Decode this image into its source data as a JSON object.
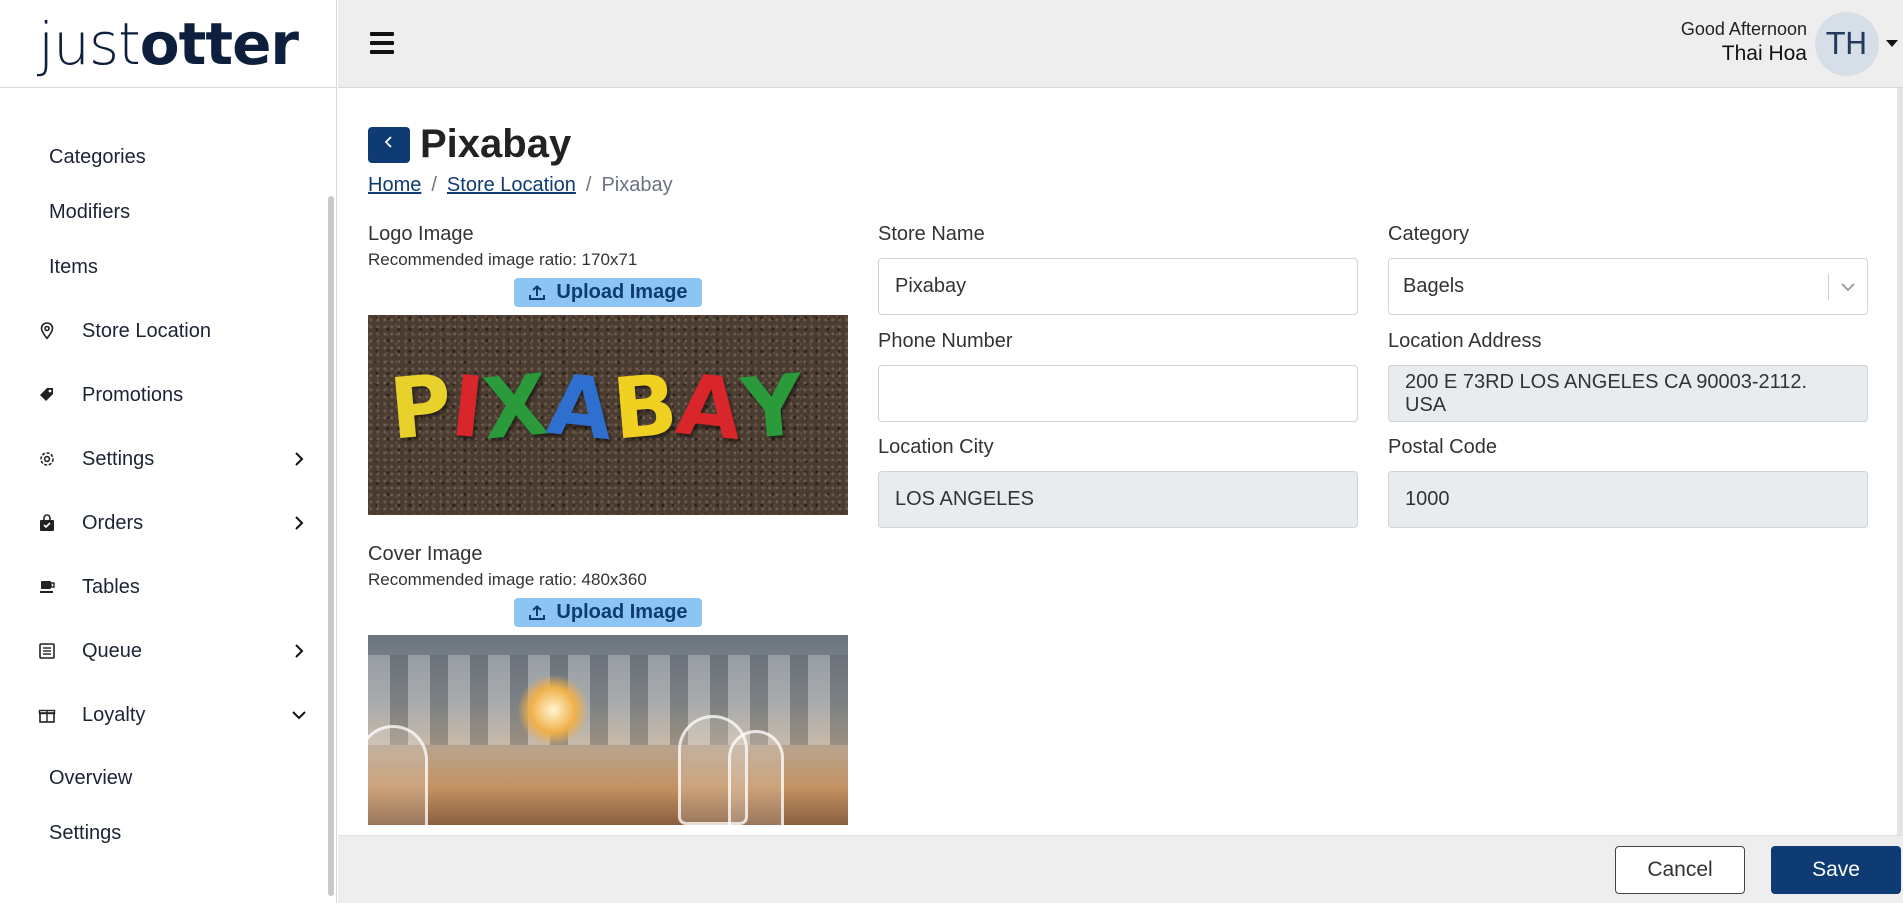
{
  "brand": {
    "logo_light": "just",
    "logo_bold": "otter"
  },
  "header": {
    "greeting": "Good Afternoon",
    "user_name": "Thai Hoa",
    "avatar_initials": "TH"
  },
  "sidebar": {
    "sub_items_top": [
      "Categories",
      "Modifiers",
      "Items"
    ],
    "items": [
      {
        "label": "Store Location",
        "icon": "map-pin-icon",
        "chevron": ""
      },
      {
        "label": "Promotions",
        "icon": "tag-icon",
        "chevron": ""
      },
      {
        "label": "Settings",
        "icon": "gear-icon",
        "chevron": "right"
      },
      {
        "label": "Orders",
        "icon": "bag-icon",
        "chevron": "right"
      },
      {
        "label": "Tables",
        "icon": "table-icon",
        "chevron": ""
      },
      {
        "label": "Queue",
        "icon": "queue-icon",
        "chevron": "right"
      },
      {
        "label": "Loyalty",
        "icon": "gift-icon",
        "chevron": "down"
      }
    ],
    "sub_items_bottom": [
      "Overview",
      "Settings"
    ]
  },
  "page": {
    "title": "Pixabay",
    "breadcrumb": {
      "home": "Home",
      "section": "Store Location",
      "current": "Pixabay",
      "separator": "/"
    }
  },
  "logo_image": {
    "label": "Logo Image",
    "hint": "Recommended image ratio: 170x71",
    "upload_label": "Upload Image",
    "letters": [
      {
        "ch": "P",
        "color": "#e8d12a"
      },
      {
        "ch": "I",
        "color": "#d8262a"
      },
      {
        "ch": "X",
        "color": "#2a9a3a"
      },
      {
        "ch": "A",
        "color": "#2f6fd0"
      },
      {
        "ch": "B",
        "color": "#f0d020"
      },
      {
        "ch": "A",
        "color": "#d8262a"
      },
      {
        "ch": "Y",
        "color": "#2a9a3a"
      }
    ]
  },
  "cover_image": {
    "label": "Cover Image",
    "hint": "Recommended image ratio: 480x360",
    "upload_label": "Upload Image"
  },
  "form": {
    "store_name": {
      "label": "Store Name",
      "value": "Pixabay"
    },
    "phone_number": {
      "label": "Phone Number",
      "value": ""
    },
    "location_city": {
      "label": "Location City",
      "value": "LOS ANGELES"
    },
    "category": {
      "label": "Category",
      "value": "Bagels"
    },
    "location_address": {
      "label": "Location Address",
      "value": "200 E 73RD LOS ANGELES CA 90003-2112. USA"
    },
    "postal_code": {
      "label": "Postal Code",
      "value": "1000"
    }
  },
  "footer": {
    "cancel_label": "Cancel",
    "save_label": "Save"
  },
  "colors": {
    "primary": "#0e3b73",
    "upload_bg": "#8cc4f3",
    "readonly_bg": "#e9ecef"
  }
}
